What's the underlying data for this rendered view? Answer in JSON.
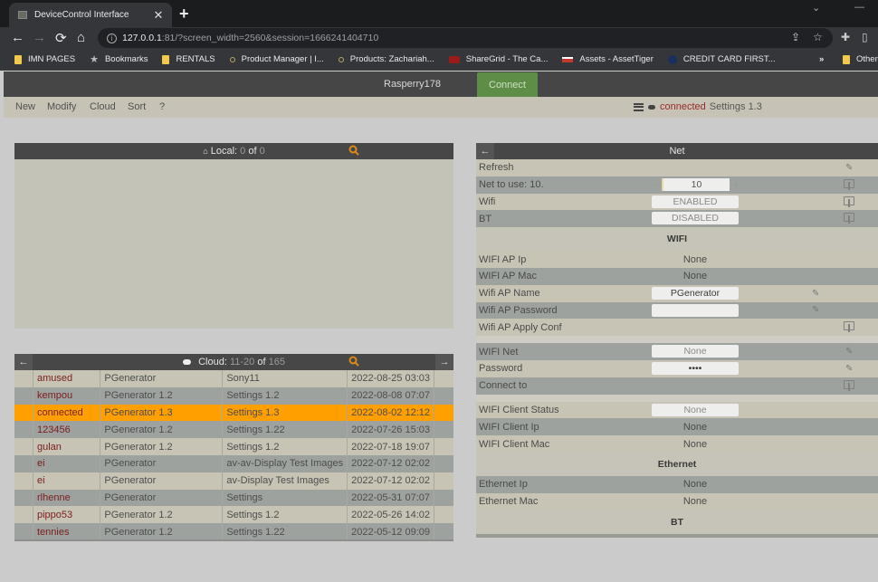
{
  "browser": {
    "tab_title": "DeviceControl Interface",
    "tab_close": "✕",
    "new_tab": "+",
    "url_host": "127.0.0.1",
    "url_rest": ":81/?screen_width=2560&session=1666241404710",
    "nav": {
      "back": "←",
      "forward": "→",
      "reload": "⟳",
      "home": "⌂"
    },
    "window_controls": {
      "tab_search": "⌄",
      "minimize": "—"
    },
    "bookmarks": [
      {
        "label": "IMN PAGES",
        "icon": "folder"
      },
      {
        "label": "Bookmarks",
        "icon": "star"
      },
      {
        "label": "RENTALS",
        "icon": "folder"
      },
      {
        "label": "Product Manager | I...",
        "icon": "site"
      },
      {
        "label": "Products: Zachariah...",
        "icon": "site"
      },
      {
        "label": "ShareGrid - The Ca...",
        "icon": "sharegrid"
      },
      {
        "label": "Assets - AssetTiger",
        "icon": "assettiger"
      },
      {
        "label": "CREDIT CARD FIRST...",
        "icon": "site"
      }
    ],
    "bookmarks_overflow": "»",
    "other_bookmarks": "Other"
  },
  "app": {
    "device_name": "Rasperry178",
    "connect_label": "Connect",
    "menu": [
      "New",
      "Modify",
      "Cloud",
      "Sort",
      "?"
    ],
    "status": {
      "state": "connected",
      "profile": "Settings 1.3"
    },
    "colors": {
      "accent": "#ff9f00",
      "connect": "#5d8d46",
      "name_text": "#7a1e1e"
    }
  },
  "local": {
    "label": "Local:",
    "current": "0",
    "of": "of",
    "total": "0"
  },
  "cloud": {
    "label": "Cloud:",
    "range": "11-20",
    "of": "of",
    "total": "165",
    "prev": "←",
    "next": "→",
    "rows": [
      {
        "name": "amused",
        "app": "PGenerator",
        "profile": "Sony11",
        "date": "2022-08-25 03:03"
      },
      {
        "name": "kempou",
        "app": "PGenerator 1.2",
        "profile": "Settings 1.2",
        "date": "2022-08-08 07:07"
      },
      {
        "name": "connected",
        "app": "PGenerator 1.3",
        "profile": "Settings 1.3",
        "date": "2022-08-02 12:12",
        "selected": true
      },
      {
        "name": "123456",
        "app": "PGenerator 1.2",
        "profile": "Settings 1.22",
        "date": "2022-07-26 15:03"
      },
      {
        "name": "gulan",
        "app": "PGenerator 1.2",
        "profile": "Settings 1.2",
        "date": "2022-07-18 19:07"
      },
      {
        "name": "ei",
        "app": "PGenerator",
        "profile": "av-av-Display Test Images",
        "date": "2022-07-12 02:02"
      },
      {
        "name": "ei",
        "app": "PGenerator",
        "profile": "av-Display Test Images",
        "date": "2022-07-12 02:02"
      },
      {
        "name": "rlhenne",
        "app": "PGenerator",
        "profile": "Settings",
        "date": "2022-05-31 07:07"
      },
      {
        "name": "pippo53",
        "app": "PGenerator 1.2",
        "profile": "Settings 1.2",
        "date": "2022-05-26 14:02"
      },
      {
        "name": "tennies",
        "app": "PGenerator 1.2",
        "profile": "Settings 1.22",
        "date": "2022-05-12 09:09"
      }
    ]
  },
  "net": {
    "title": "Net",
    "back": "←",
    "refresh": "Refresh",
    "net_to_use_label": "Net to use: 10.",
    "net_to_use_value": "10",
    "minus": "−",
    "plus": "+",
    "wifi_label": "Wifi",
    "wifi_value": "ENABLED",
    "bt_label": "BT",
    "bt_value": "DISABLED",
    "section_wifi": "WIFI",
    "ap_ip_label": "WIFI AP Ip",
    "ap_ip_value": "None",
    "ap_mac_label": "WIFI AP Mac",
    "ap_mac_value": "None",
    "ap_name_label": "Wifi AP Name",
    "ap_name_value": "PGenerator",
    "ap_password_label": "Wifi AP Password",
    "ap_password_value": "",
    "ap_apply_label": "Wifi AP Apply Conf",
    "wifi_net_label": "WIFI Net",
    "wifi_net_value": "None",
    "password_label": "Password",
    "password_value": "••••",
    "connect_to_label": "Connect to",
    "client_status_label": "WIFI Client Status",
    "client_status_value": "None",
    "client_ip_label": "WIFI Client Ip",
    "client_ip_value": "None",
    "client_mac_label": "WIFI Client Mac",
    "client_mac_value": "None",
    "section_ethernet": "Ethernet",
    "eth_ip_label": "Ethernet Ip",
    "eth_ip_value": "None",
    "eth_mac_label": "Ethernet Mac",
    "eth_mac_value": "None",
    "section_bt": "BT"
  }
}
